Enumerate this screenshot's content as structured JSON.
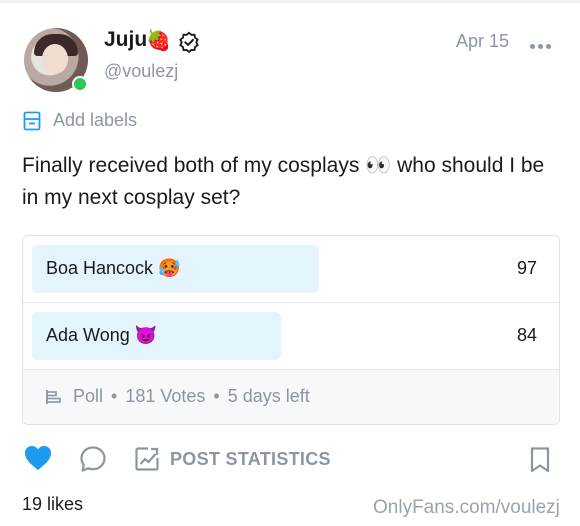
{
  "header": {
    "name": "Juju",
    "name_emoji": "🍓",
    "handle": "@voulezj",
    "date": "Apr 15",
    "verified_icon": "verified-badge-icon",
    "more_icon": "more-dots-icon"
  },
  "labels": {
    "text": "Add labels"
  },
  "post": {
    "text": "Finally received both of my cosplays 👀 who should I be in my next cosplay set?"
  },
  "poll": {
    "options": [
      {
        "label": "Boa Hancock 🥵",
        "votes": "97",
        "fill_fraction": 0.536
      },
      {
        "label": "Ada Wong 😈",
        "votes": "84",
        "fill_fraction": 0.464
      }
    ],
    "type_label": "Poll",
    "votes_label": "181 Votes",
    "time_left": "5 days left"
  },
  "actions": {
    "stats_label": "POST STATISTICS",
    "accent_color": "#1d9bf0"
  },
  "footer": {
    "likes": "19 likes",
    "site": "OnlyFans.com/voulezj"
  }
}
